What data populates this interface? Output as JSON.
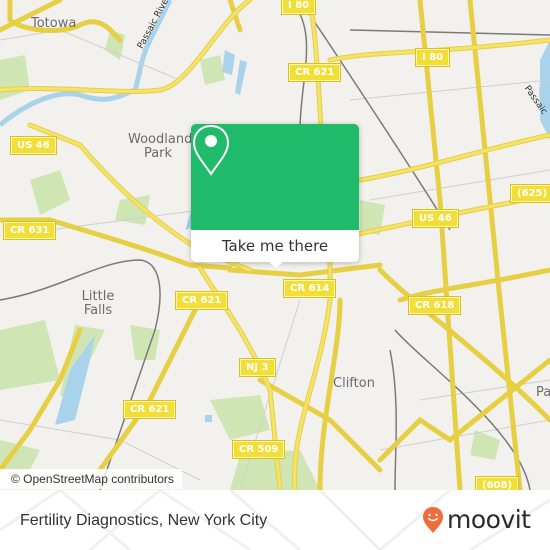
{
  "map": {
    "places": [
      {
        "name": "Totowa"
      },
      {
        "name": "Woodland Park"
      },
      {
        "name": "Little Falls"
      },
      {
        "name": "Clifton"
      },
      {
        "name": "Pa"
      }
    ],
    "road_shields": [
      {
        "label": "I 80"
      },
      {
        "label": "I 80"
      },
      {
        "label": "CR 621"
      },
      {
        "label": "US 46"
      },
      {
        "label": "CR 631"
      },
      {
        "label": "(625)"
      },
      {
        "label": "US 46"
      },
      {
        "label": "CR 621"
      },
      {
        "label": "CR 614"
      },
      {
        "label": "CR 618"
      },
      {
        "label": "NJ 3"
      },
      {
        "label": "CR 621"
      },
      {
        "label": "CR 509"
      },
      {
        "label": "(608)"
      }
    ],
    "rivers": [
      {
        "name": "Passaic River"
      },
      {
        "name": "Passaic"
      }
    ],
    "attribution": "© OpenStreetMap contributors",
    "colors": {
      "background": "#f2f1ed",
      "road": "#f5e26a",
      "water": "#a9d3ea",
      "park": "#cfe6b4"
    }
  },
  "popup": {
    "icon": "location-pin-icon",
    "button_label": "Take me there",
    "accent_color": "#1fba6a"
  },
  "footer": {
    "title": "Fertility Diagnostics, New York City",
    "brand": "moovit",
    "brand_color": "#f26c3b"
  }
}
